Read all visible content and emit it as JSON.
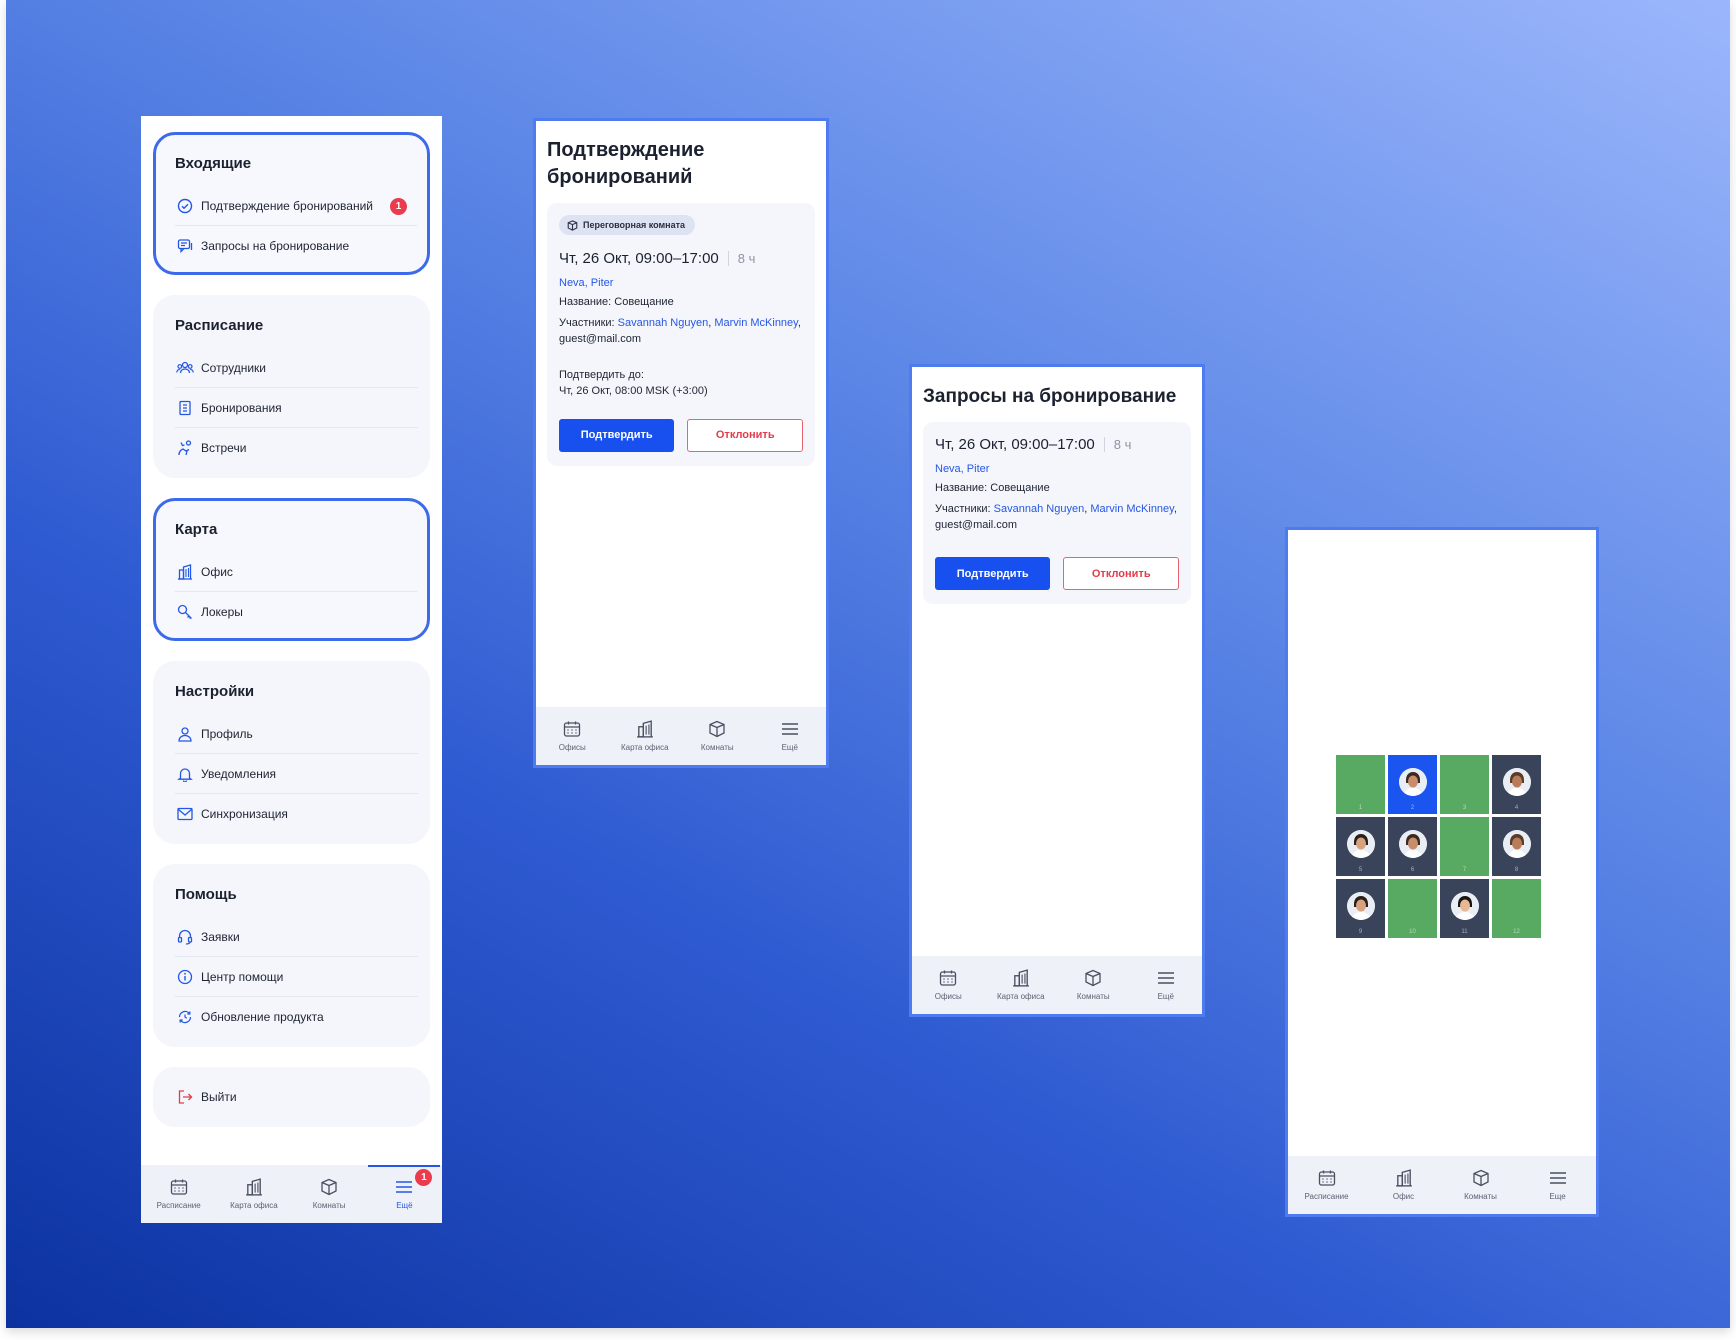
{
  "menu": {
    "sections": [
      {
        "title": "Входящие",
        "highlight": true,
        "items": [
          {
            "label": "Подтверждение бронирований",
            "icon": "check-circle-icon",
            "badge": "1"
          },
          {
            "label": "Запросы на бронирование",
            "icon": "chat-icon"
          }
        ]
      },
      {
        "title": "Расписание",
        "highlight": false,
        "items": [
          {
            "label": "Сотрудники",
            "icon": "people-icon"
          },
          {
            "label": "Бронирования",
            "icon": "document-icon"
          },
          {
            "label": "Встречи",
            "icon": "handshake-icon"
          }
        ]
      },
      {
        "title": "Карта",
        "highlight": true,
        "items": [
          {
            "label": "Офис",
            "icon": "building-icon"
          },
          {
            "label": "Локеры",
            "icon": "key-icon"
          }
        ]
      },
      {
        "title": "Настройки",
        "highlight": false,
        "items": [
          {
            "label": "Профиль",
            "icon": "user-icon"
          },
          {
            "label": "Уведомления",
            "icon": "bell-icon"
          },
          {
            "label": "Синхронизация",
            "icon": "mail-icon"
          }
        ]
      },
      {
        "title": "Помощь",
        "highlight": false,
        "items": [
          {
            "label": "Заявки",
            "icon": "headset-icon"
          },
          {
            "label": "Центр помощи",
            "icon": "info-icon"
          },
          {
            "label": "Обновление продукта",
            "icon": "refresh-icon"
          }
        ]
      }
    ],
    "logout": {
      "label": "Выйти",
      "icon": "logout-icon"
    },
    "nav": [
      {
        "label": "Расписание",
        "icon": "calendar-icon"
      },
      {
        "label": "Карта офиса",
        "icon": "building-icon"
      },
      {
        "label": "Комнаты",
        "icon": "room-icon"
      },
      {
        "label": "Ещё",
        "icon": "menu-icon",
        "active": true,
        "badge": "1"
      }
    ]
  },
  "confirm": {
    "title": "Подтверждение бронирований",
    "chip": "Переговорная комната",
    "time": "Чт, 26 Окт, 09:00–17:00",
    "duration": "8 ч",
    "location": "Neva, Piter",
    "name_label": "Название:",
    "name_value": "Совещание",
    "participants_label": "Участники:",
    "participant_1": "Savannah Nguyen",
    "participant_2": "Marvin McKinney",
    "guest": "guest@mail.com",
    "deadline_label": "Подтвердить до:",
    "deadline_value": "Чт, 26 Окт, 08:00 MSK (+3:00)",
    "confirm_btn": "Подтвердить",
    "decline_btn": "Отклонить",
    "nav": [
      {
        "label": "Офисы",
        "icon": "calendar-icon"
      },
      {
        "label": "Карта офиса",
        "icon": "building-icon"
      },
      {
        "label": "Комнаты",
        "icon": "room-icon"
      },
      {
        "label": "Ещё",
        "icon": "menu-icon"
      }
    ]
  },
  "requests": {
    "title": "Запросы на бронирование",
    "time": "Чт, 26 Окт, 09:00–17:00",
    "duration": "8 ч",
    "location": "Neva, Piter",
    "name_label": "Название:",
    "name_value": "Совещание",
    "participants_label": "Участники:",
    "participant_1": "Savannah Nguyen",
    "participant_2": "Marvin McKinney",
    "guest": "guest@mail.com",
    "confirm_btn": "Подтвердить",
    "decline_btn": "Отклонить",
    "nav": [
      {
        "label": "Офисы",
        "icon": "calendar-icon"
      },
      {
        "label": "Карта офиса",
        "icon": "building-icon"
      },
      {
        "label": "Комнаты",
        "icon": "room-icon"
      },
      {
        "label": "Ещё",
        "icon": "menu-icon"
      }
    ]
  },
  "map": {
    "seats": [
      "free",
      "mine",
      "free",
      "busy",
      "busy",
      "busy",
      "free",
      "busy",
      "busy",
      "free",
      "busy",
      "free"
    ],
    "seat_numbers": [
      "1",
      "2",
      "3",
      "4",
      "5",
      "6",
      "7",
      "8",
      "9",
      "10",
      "11",
      "12"
    ],
    "nav": [
      {
        "label": "Расписание",
        "icon": "calendar-icon"
      },
      {
        "label": "Офис",
        "icon": "building-icon"
      },
      {
        "label": "Комнаты",
        "icon": "room-icon"
      },
      {
        "label": "Еще",
        "icon": "menu-icon"
      }
    ]
  },
  "colors": {
    "accent": "#1750ef",
    "danger": "#e23c4b",
    "seat_free": "#58aa63",
    "seat_busy": "#39435a",
    "seat_mine": "#1a55f0"
  }
}
